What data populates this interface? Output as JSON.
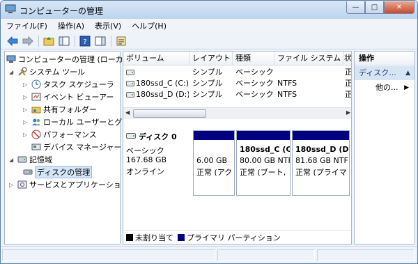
{
  "window": {
    "title": "コンピューターの管理"
  },
  "menu": [
    "ファイル(F)",
    "操作(A)",
    "表示(V)",
    "ヘルプ(H)"
  ],
  "tree": {
    "root": "コンピューターの管理 (ローカ",
    "system_tools": "システム ツール",
    "task_scheduler": "タスク スケジューラ",
    "event_viewer": "イベント ビューアー",
    "shared_folders": "共有フォルダー",
    "local_users": "ローカル ユーザーとグ",
    "performance": "パフォーマンス",
    "device_manager": "デバイス マネージャー",
    "storage": "記憶域",
    "disk_management": "ディスクの管理",
    "services": "サービスとアプリケーショ"
  },
  "volume_list": {
    "columns": [
      "ボリューム",
      "レイアウト",
      "種類",
      "ファイル システム",
      "状"
    ],
    "rows": [
      {
        "volume": "",
        "layout": "シンプル",
        "type": "ベーシック",
        "fs": "",
        "status": "正"
      },
      {
        "volume": "180ssd_C (C:)",
        "layout": "シンプル",
        "type": "ベーシック",
        "fs": "NTFS",
        "status": "正"
      },
      {
        "volume": "180ssd_D (D:)",
        "layout": "シンプル",
        "type": "ベーシック",
        "fs": "NTFS",
        "status": "正"
      }
    ]
  },
  "disk": {
    "name": "ディスク 0",
    "kind": "ベーシック",
    "size": "167.68 GB",
    "state": "オンライン",
    "partitions": [
      {
        "name": "",
        "size": "6.00 GB",
        "status": "正常 (アク"
      },
      {
        "name": "180ssd_C (C",
        "size": "80.00 GB NTF",
        "status": "正常 (ブート,"
      },
      {
        "name": "180ssd_D (D",
        "size": "81.68 GB NTF",
        "status": "正常 (プライマ"
      }
    ]
  },
  "legend": {
    "unallocated": "未割り当て",
    "primary": "プライマリ パーティション"
  },
  "actions": {
    "header": "操作",
    "section": "ディスク...",
    "other": "他の..."
  },
  "colors": {
    "partition_bar": "#000080",
    "unallocated": "#000000",
    "selection": "#d5e5f8"
  }
}
